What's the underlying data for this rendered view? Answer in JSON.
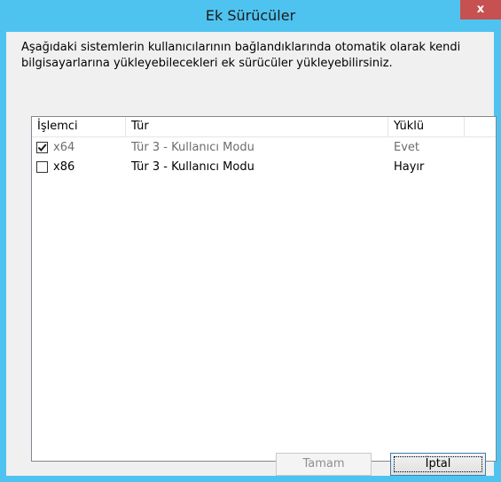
{
  "window": {
    "title": "Ek Sürücüler",
    "close_label": "x"
  },
  "description": "Aşağıdaki sistemlerin kullanıcılarının bağlandıklarında otomatik olarak kendi bilgisayarlarına yükleyebilecekleri ek sürücüler yükleyebilirsiniz.",
  "list": {
    "columns": [
      "İşlemci",
      "Tür",
      "Yüklü"
    ],
    "rows": [
      {
        "processor": "x64",
        "type": "Tür 3 - Kullanıcı Modu",
        "installed": "Evet",
        "checked": true,
        "disabled": true
      },
      {
        "processor": "x86",
        "type": "Tür 3 - Kullanıcı Modu",
        "installed": "Hayır",
        "checked": false,
        "disabled": false
      }
    ]
  },
  "buttons": {
    "ok": "Tamam",
    "cancel": "İptal"
  },
  "colors": {
    "titlebar": "#4fc3f0",
    "close": "#c75050"
  }
}
